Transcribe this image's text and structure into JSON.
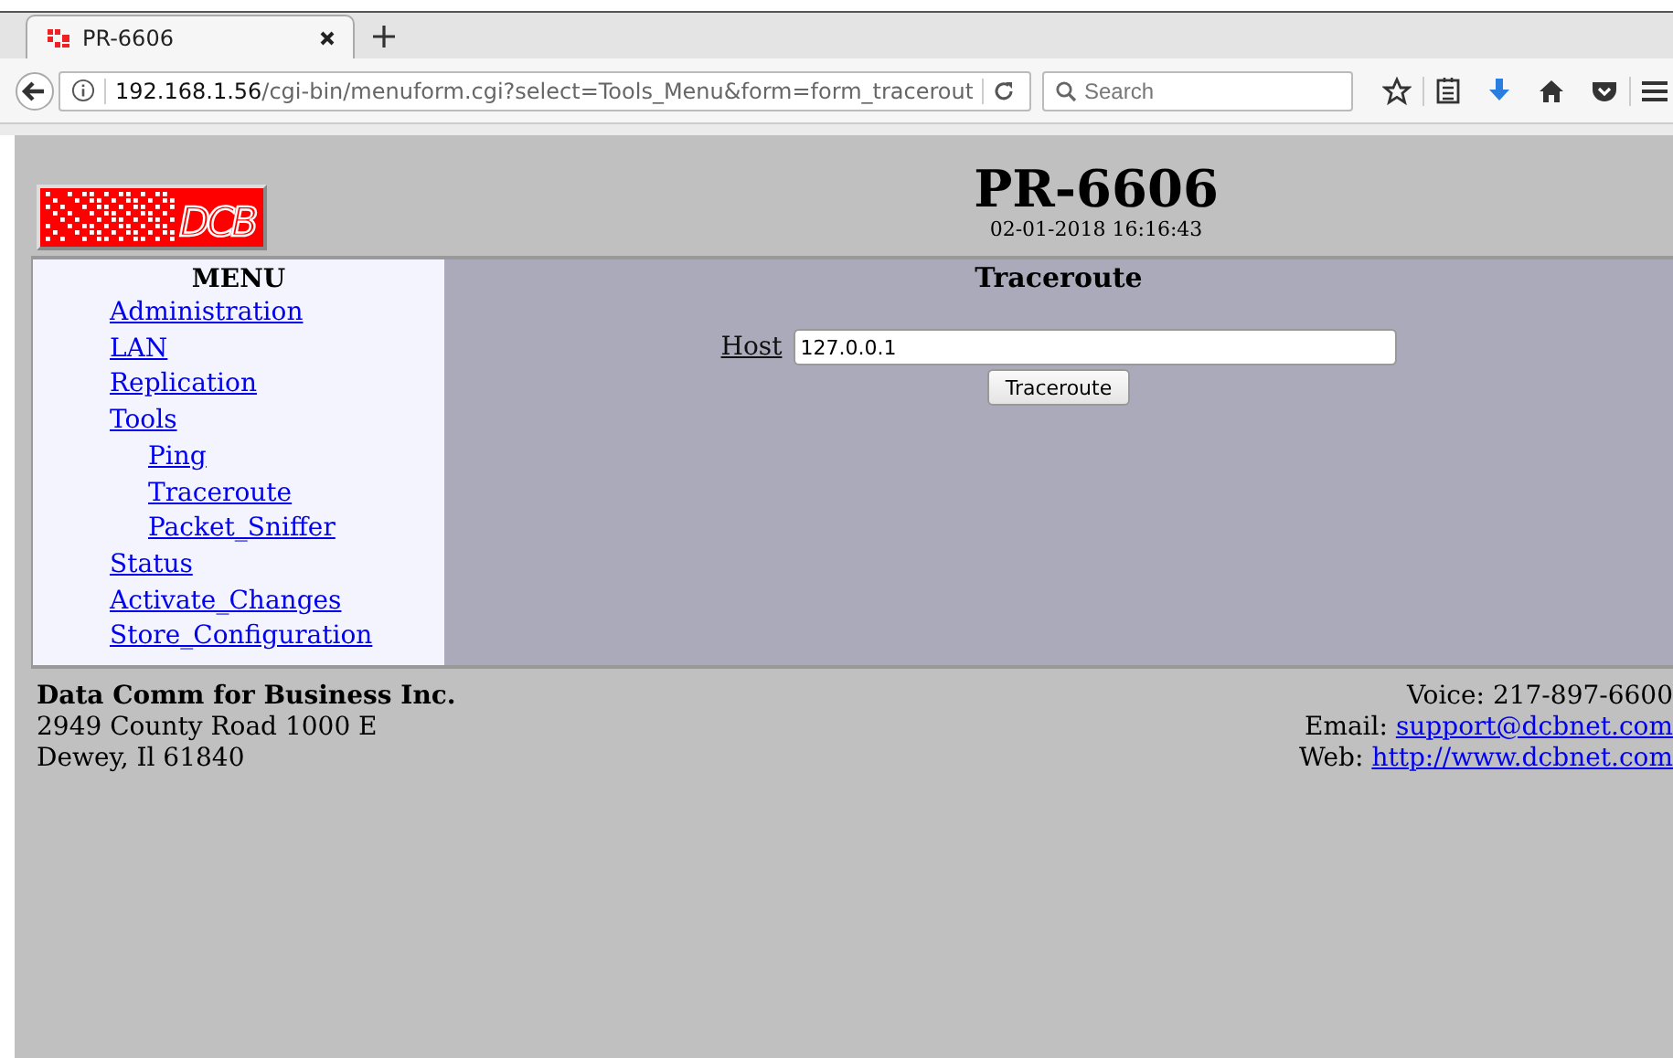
{
  "browser": {
    "tab": {
      "title": "PR-6606",
      "selected": true
    },
    "url_host": "192.168.1.56",
    "url_path": "/cgi-bin/menuform.cgi?select=Tools_Menu&form=form_tracerout",
    "search": {
      "placeholder": "Search"
    }
  },
  "header": {
    "logo_text": "DCB",
    "title": "PR-6606",
    "datetime": "02-01-2018 16:16:43"
  },
  "menu": {
    "heading": "MENU",
    "items": [
      {
        "label": "Administration"
      },
      {
        "label": "LAN"
      },
      {
        "label": "Replication"
      },
      {
        "label": "Tools",
        "children": [
          {
            "label": "Ping"
          },
          {
            "label": "Traceroute"
          },
          {
            "label": "Packet_Sniffer"
          }
        ]
      },
      {
        "label": "Status"
      },
      {
        "label": "Activate_Changes"
      },
      {
        "label": "Store_Configuration"
      }
    ]
  },
  "panel": {
    "heading": "Traceroute",
    "host_label": "Host",
    "host_value": "127.0.0.1",
    "button": "Traceroute"
  },
  "footer": {
    "company": "Data Comm for Business Inc.",
    "address": [
      "2949 County Road 1000 E",
      "Dewey, Il 61840"
    ],
    "contacts": [
      {
        "label": "Voice: ",
        "value": "217-897-6600",
        "kind": "text"
      },
      {
        "label": "Email: ",
        "value": "support@dcbnet.com",
        "kind": "link"
      },
      {
        "label": "Web: ",
        "value": "http://www.dcbnet.com",
        "kind": "link"
      }
    ]
  }
}
